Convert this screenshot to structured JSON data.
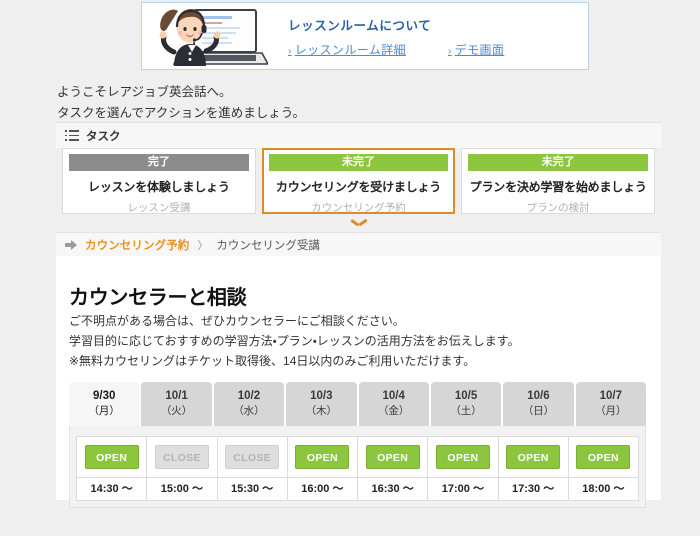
{
  "banner": {
    "illustration": "counselor-laptop-illustration",
    "title": "レッスンルームについて",
    "links": [
      {
        "caret": "›",
        "label": "レッスンルーム詳細"
      },
      {
        "caret": "›",
        "label": "デモ画面"
      }
    ]
  },
  "welcome": {
    "line1": "ようこそレアジョブ英会話へ。",
    "line2": "タスクを選んでアクションを進めましょう。"
  },
  "task_panel": {
    "header_label": "タスク",
    "header_icon": "list-icon",
    "cards": [
      {
        "status": "完了",
        "status_type": "done",
        "title": "レッスンを体験しましょう",
        "subtitle": "レッスン受講",
        "selected": false
      },
      {
        "status": "未完了",
        "status_type": "todo",
        "title": "カウンセリングを受けましょう",
        "subtitle": "カウンセリング予約",
        "selected": true
      },
      {
        "status": "未完了",
        "status_type": "todo",
        "title": "プランを決め学習を始めましょう",
        "subtitle": "プランの検討",
        "selected": false
      }
    ]
  },
  "chevron_icon": "chevron-down-icon",
  "breadcrumb": {
    "arrow_icon": "arrow-right-icon",
    "active": "カウンセリング予約",
    "separator": "〉",
    "next": "カウンセリング受講"
  },
  "main": {
    "heading": "カウンセラーと相談",
    "lead_line1": "ご不明点がある場合は、ぜひカウンセラーにご相談ください。",
    "lead_line2": "学習目的に応じておすすめの学習方法・プラン・レッスンの活用方法をお伝えします。",
    "lead_line3": "※無料カウセリングはチケット取得後、14日以内のみご利用いただけます。"
  },
  "calendar": {
    "dates": [
      {
        "date": "9/30",
        "dow": "（月）",
        "active": true
      },
      {
        "date": "10/1",
        "dow": "（火）",
        "active": false
      },
      {
        "date": "10/2",
        "dow": "（水）",
        "active": false
      },
      {
        "date": "10/3",
        "dow": "（木）",
        "active": false
      },
      {
        "date": "10/4",
        "dow": "（金）",
        "active": false
      },
      {
        "date": "10/5",
        "dow": "（土）",
        "active": false
      },
      {
        "date": "10/6",
        "dow": "（日）",
        "active": false
      },
      {
        "date": "10/7",
        "dow": "（月）",
        "active": false
      }
    ],
    "slots": [
      {
        "time": "14:30 〜",
        "status": "OPEN",
        "available": true
      },
      {
        "time": "15:00 〜",
        "status": "CLOSE",
        "available": false
      },
      {
        "time": "15:30 〜",
        "status": "CLOSE",
        "available": false
      },
      {
        "time": "16:00 〜",
        "status": "OPEN",
        "available": true
      },
      {
        "time": "16:30 〜",
        "status": "OPEN",
        "available": true
      },
      {
        "time": "17:00 〜",
        "status": "OPEN",
        "available": true
      },
      {
        "time": "17:30 〜",
        "status": "OPEN",
        "available": true
      },
      {
        "time": "18:00 〜",
        "status": "OPEN",
        "available": true
      }
    ]
  },
  "colors": {
    "green": "#8cc63f",
    "gray_status": "#8c8c8c",
    "orange": "#e8921f",
    "selected_border": "#e08b28",
    "link_blue": "#4b8ad6",
    "banner_title_blue": "#2b5fa8",
    "page_bg": "#efefef"
  }
}
